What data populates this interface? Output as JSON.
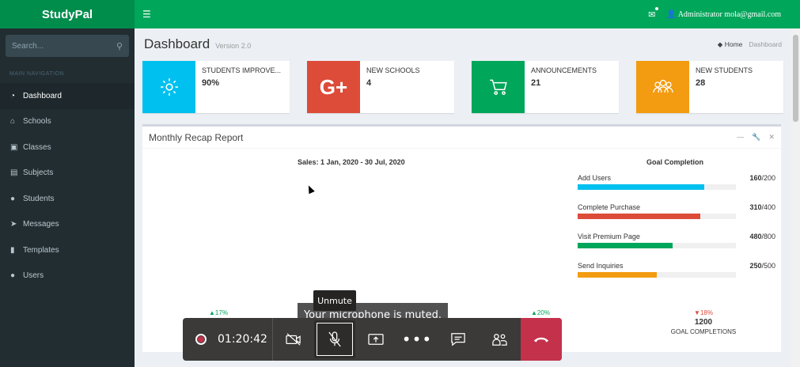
{
  "brand": "StudyPal",
  "sidebar": {
    "search_placeholder": "Search...",
    "header": "MAIN NAVIGATION",
    "items": [
      {
        "label": "Dashboard",
        "icon": "dashboard-icon"
      },
      {
        "label": "Schools",
        "icon": "bank-icon"
      },
      {
        "label": "Classes",
        "icon": "classes-icon"
      },
      {
        "label": "Subjects",
        "icon": "book-icon"
      },
      {
        "label": "Students",
        "icon": "users-icon"
      },
      {
        "label": "Messages",
        "icon": "paper-plane-icon"
      },
      {
        "label": "Templates",
        "icon": "file-icon"
      },
      {
        "label": "Users",
        "icon": "users-icon"
      }
    ]
  },
  "topbar": {
    "user": "Administrator mola@gmail.com"
  },
  "page": {
    "title": "Dashboard",
    "subtitle": "Version 2.0",
    "breadcrumb": [
      "Home",
      "Dashboard"
    ]
  },
  "stats": [
    {
      "label": "STUDENTS IMPROVE...",
      "value": "90%",
      "color": "#00c0ef",
      "icon": "gear-icon"
    },
    {
      "label": "NEW SCHOOLS",
      "value": "4",
      "color": "#dd4b39",
      "icon": "google-plus-icon"
    },
    {
      "label": "ANNOUNCEMENTS",
      "value": "21",
      "color": "#00a65a",
      "icon": "cart-icon"
    },
    {
      "label": "NEW STUDENTS",
      "value": "28",
      "color": "#f39c12",
      "icon": "group-icon"
    }
  ],
  "report": {
    "title": "Monthly Recap Report",
    "sales_title": "Sales: 1 Jan, 2020 - 30 Jul, 2020",
    "goal_title": "Goal Completion",
    "goals": [
      {
        "label": "Add Users",
        "value": "160",
        "total": "/200",
        "fraction": 0.8,
        "color": "#00c0ef"
      },
      {
        "label": "Complete Purchase",
        "value": "310",
        "total": "/400",
        "fraction": 0.775,
        "color": "#dd4b39"
      },
      {
        "label": "Visit Premium Page",
        "value": "480",
        "total": "/800",
        "fraction": 0.6,
        "color": "#00a65a"
      },
      {
        "label": "Send Inquiries",
        "value": "250",
        "total": "/500",
        "fraction": 0.5,
        "color": "#f39c12"
      }
    ],
    "footer": [
      {
        "pct": "▲17%",
        "dir": "up"
      },
      {
        "pct": "▲20%",
        "dir": "up"
      },
      {
        "pct": "▼18%",
        "dir": "down",
        "value": "1200",
        "label": "GOAL COMPLETIONS"
      }
    ]
  },
  "call": {
    "time": "01:20:42",
    "toast": "Your microphone is muted.",
    "tooltip": "Unmute"
  }
}
